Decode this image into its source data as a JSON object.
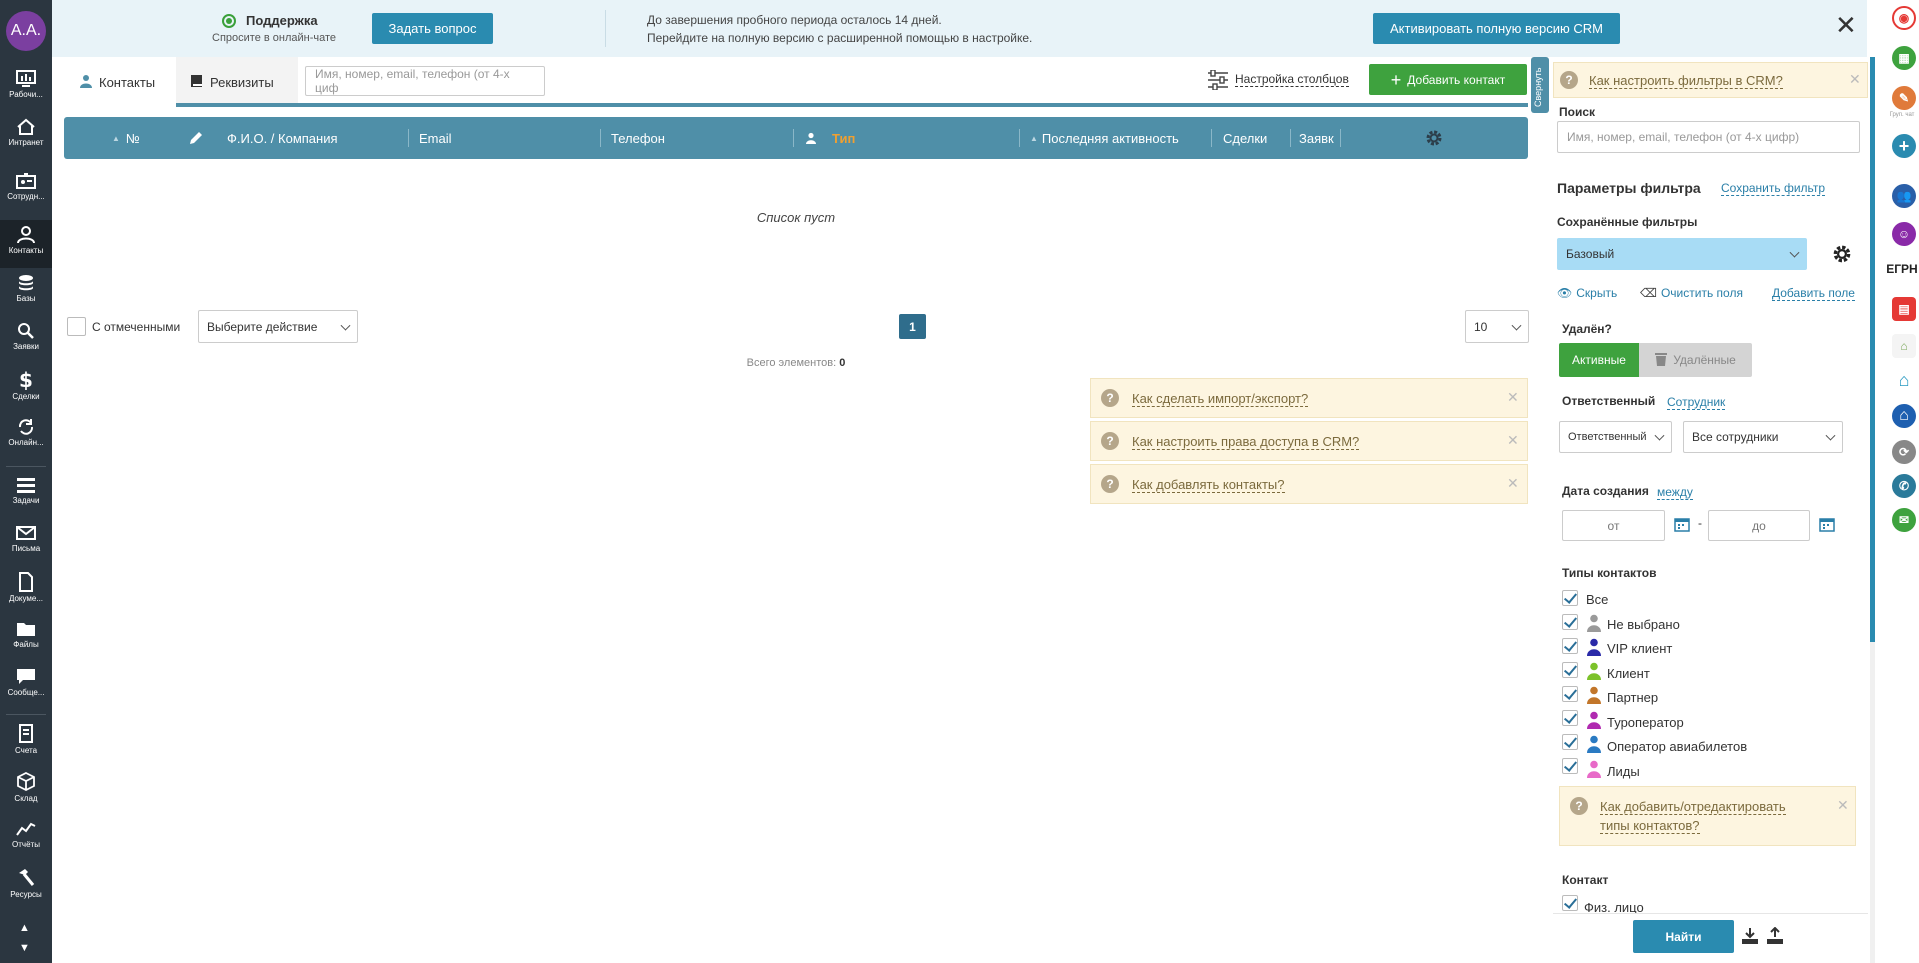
{
  "user": {
    "initials": "A.A."
  },
  "leftnav": [
    {
      "key": "desktop",
      "label": "Рабочи..."
    },
    {
      "key": "intranet",
      "label": "Интранет"
    },
    {
      "key": "staff",
      "label": "Сотрудн..."
    },
    {
      "key": "contacts",
      "label": "Контакты"
    },
    {
      "key": "bases",
      "label": "Базы"
    },
    {
      "key": "requests",
      "label": "Заявки"
    },
    {
      "key": "deals",
      "label": "Сделки"
    },
    {
      "key": "online",
      "label": "Онлайн..."
    },
    {
      "key": "tasks",
      "label": "Задачи"
    },
    {
      "key": "mail",
      "label": "Письма"
    },
    {
      "key": "docs",
      "label": "Докуме..."
    },
    {
      "key": "files",
      "label": "Файлы"
    },
    {
      "key": "messages",
      "label": "Сообще..."
    },
    {
      "key": "invoices",
      "label": "Счета"
    },
    {
      "key": "warehouse",
      "label": "Склад"
    },
    {
      "key": "reports",
      "label": "Отчёты"
    },
    {
      "key": "resources",
      "label": "Ресурсы"
    }
  ],
  "banner": {
    "support_title": "Поддержка",
    "support_sub": "Спросите в онлайн-чате",
    "ask_button": "Задать вопрос",
    "trial_line1": "До завершения пробного периода осталось 14 дней.",
    "trial_line2": "Перейдите на полную версию с расширенной помощью в настройке.",
    "activate_button": "Активировать полную версию CRM",
    "close": "✕"
  },
  "toolbar": {
    "tab_contacts": "Контакты",
    "tab_requisites": "Реквизиты",
    "search_placeholder": "Имя, номер, email, телефон (от 4-х циф",
    "columns_settings": "Настройка столбцов",
    "add_contact": "Добавить контакт",
    "collapse": "Свернуть"
  },
  "table": {
    "columns": [
      "№",
      "Ф.И.О. / Компания",
      "Email",
      "Телефон",
      "Тип",
      "Последняя активность",
      "Сделки",
      "Заявк"
    ],
    "empty_text": "Список пуст"
  },
  "footer": {
    "with_selected": "С отмеченными",
    "action_select": "Выберите действие",
    "page": "1",
    "per_page": "10",
    "total_label": "Всего элементов:",
    "total_value": "0"
  },
  "help_main": [
    "Как сделать импорт/экспорт?",
    "Как настроить права доступа в CRM?",
    "Как добавлять контакты?"
  ],
  "filter": {
    "help_top": "Как настроить фильтры в CRM?",
    "search_label": "Поиск",
    "search_placeholder": "Имя, номер, email, телефон (от 4-х цифр)",
    "params_title": "Параметры фильтра",
    "save_filter": "Сохранить фильтр",
    "saved_filters_label": "Сохранённые фильтры",
    "saved_filter_value": "Базовый",
    "hide": "Скрыть",
    "clear_fields": "Очистить поля",
    "add_field": "Добавить поле",
    "deleted_label": "Удалён?",
    "active_btn": "Активные",
    "deleted_btn": "Удалённые",
    "responsible_label": "Ответственный",
    "employee_link": "Сотрудник",
    "responsible_select": "Ответственный",
    "all_staff_select": "Все сотрудники",
    "date_label": "Дата создания",
    "between_link": "между",
    "from_placeholder": "от",
    "to_placeholder": "до",
    "date_dash": "-",
    "types_label": "Типы контактов",
    "types": [
      {
        "name": "Все",
        "color": ""
      },
      {
        "name": "Не выбрано",
        "color": "#9a9a9a"
      },
      {
        "name": "VIP клиент",
        "color": "#2a2aa8"
      },
      {
        "name": "Клиент",
        "color": "#7cc22a"
      },
      {
        "name": "Партнер",
        "color": "#c2762a"
      },
      {
        "name": "Туроператор",
        "color": "#b02ab0"
      },
      {
        "name": "Оператор авиабилетов",
        "color": "#2a7ac2"
      },
      {
        "name": "Лиды",
        "color": "#e86ac8"
      }
    ],
    "help_types_line1": "Как добавить/отредактировать",
    "help_types_line2": "типы контактов?",
    "contact_label": "Контакт",
    "phys_person": "Физ. лицо",
    "find_button": "Найти"
  },
  "rightbar": {
    "egrn": "ЕГРН",
    "small_label": "Груп. чат"
  }
}
